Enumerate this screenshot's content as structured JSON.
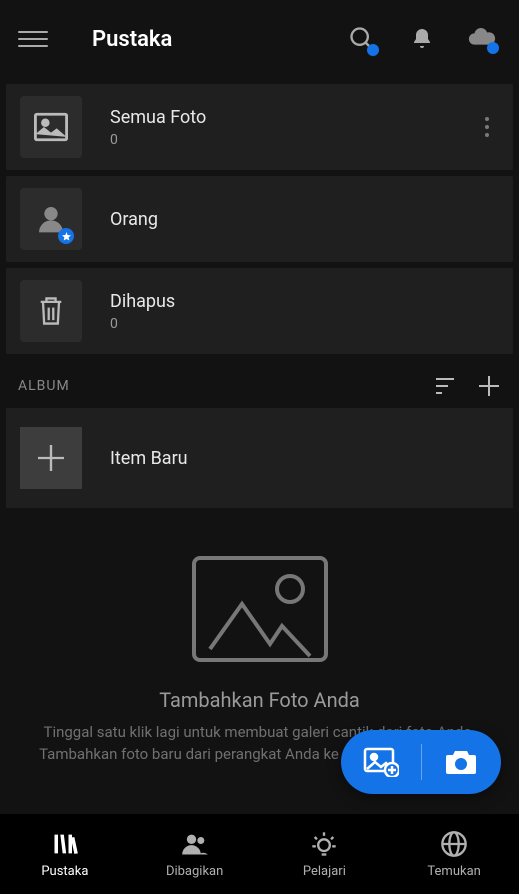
{
  "header": {
    "title": "Pustaka"
  },
  "library": {
    "all_photos": {
      "title": "Semua Foto",
      "count": "0"
    },
    "people": {
      "title": "Orang"
    },
    "deleted": {
      "title": "Dihapus",
      "count": "0"
    }
  },
  "album_section": {
    "label": "ALBUM",
    "new_item": "Item Baru"
  },
  "empty": {
    "title": "Tambahkan Foto Anda",
    "desc": "Tinggal satu klik lagi untuk membuat galeri cantik dari foto Anda. Tambahkan foto baru dari perangkat Anda ke Lightroom sekarang."
  },
  "nav": {
    "library": "Pustaka",
    "shared": "Dibagikan",
    "learn": "Pelajari",
    "discover": "Temukan"
  }
}
